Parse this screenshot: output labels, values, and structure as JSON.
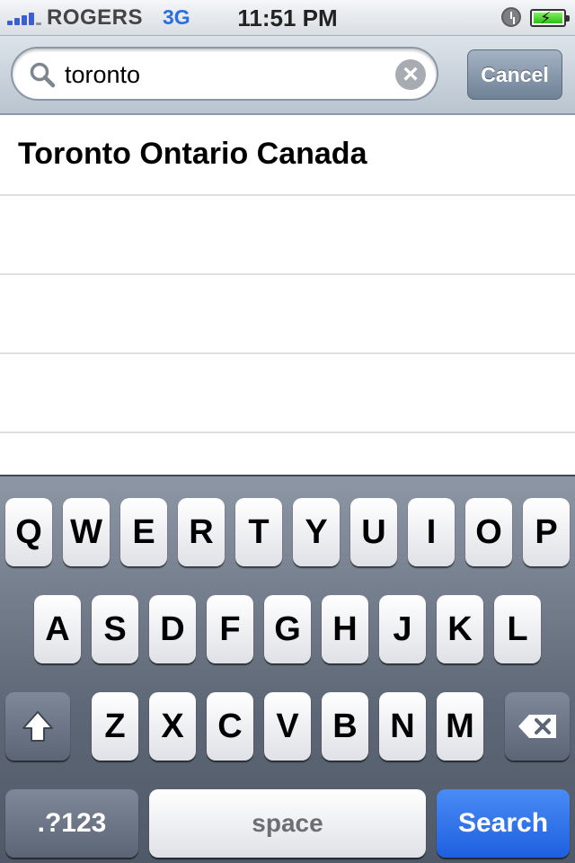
{
  "status_bar": {
    "carrier": "ROGERS",
    "network": "3G",
    "time": "11:51 PM",
    "icons": [
      "signal-strength-icon",
      "alarm-icon",
      "battery-charging-icon"
    ]
  },
  "search": {
    "value": "toronto",
    "cancel_label": "Cancel",
    "icons": [
      "search-icon",
      "clear-icon"
    ]
  },
  "results": [
    {
      "label": "Toronto Ontario Canada"
    },
    {
      "label": ""
    },
    {
      "label": ""
    },
    {
      "label": ""
    },
    {
      "label": ""
    }
  ],
  "keyboard": {
    "row1": [
      "Q",
      "W",
      "E",
      "R",
      "T",
      "Y",
      "U",
      "I",
      "O",
      "P"
    ],
    "row2": [
      "A",
      "S",
      "D",
      "F",
      "G",
      "H",
      "J",
      "K",
      "L"
    ],
    "row3": [
      "Z",
      "X",
      "C",
      "V",
      "B",
      "N",
      "M"
    ],
    "numbers_label": ".?123",
    "space_label": "space",
    "search_label": "Search",
    "icons": [
      "shift-icon",
      "delete-icon"
    ]
  },
  "colors": {
    "accent": "#1e5fe0",
    "network": "#2a6fe0",
    "battery": "#2ebd16"
  }
}
